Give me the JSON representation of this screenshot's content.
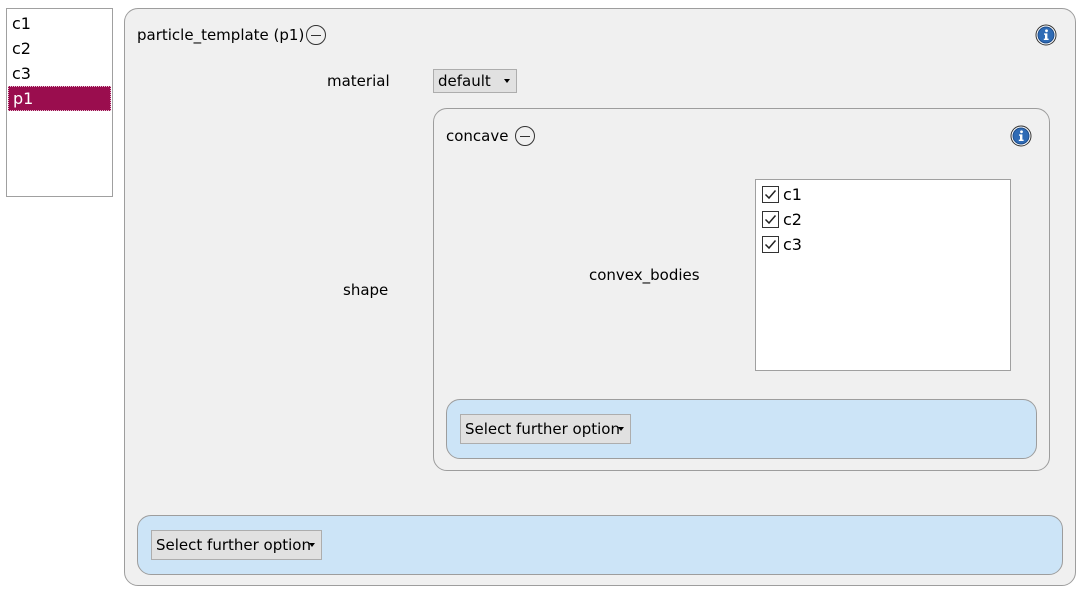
{
  "left_list": {
    "items": [
      {
        "label": "c1",
        "selected": false
      },
      {
        "label": "c2",
        "selected": false
      },
      {
        "label": "c3",
        "selected": false
      },
      {
        "label": "p1",
        "selected": true
      }
    ]
  },
  "panel": {
    "title": "particle_template (p1)",
    "material_label": "material",
    "material_value": "default",
    "shape_label": "shape",
    "further_option_label": "Select further option"
  },
  "concave": {
    "title": "concave",
    "convex_bodies_label": "convex_bodies",
    "bodies": [
      {
        "label": "c1",
        "checked": true
      },
      {
        "label": "c2",
        "checked": true
      },
      {
        "label": "c3",
        "checked": true
      }
    ],
    "further_option_label": "Select further option"
  },
  "colors": {
    "selection": "#9a0d4e",
    "panel_bg": "#f0f0f0",
    "further_bg": "#cce4f7",
    "info_icon": "#1f4e8c"
  },
  "icons": {
    "collapse": "minus-circle-icon",
    "info": "info-circle-icon",
    "check": "checkmark-icon",
    "dropdown": "triangle-down-icon"
  }
}
